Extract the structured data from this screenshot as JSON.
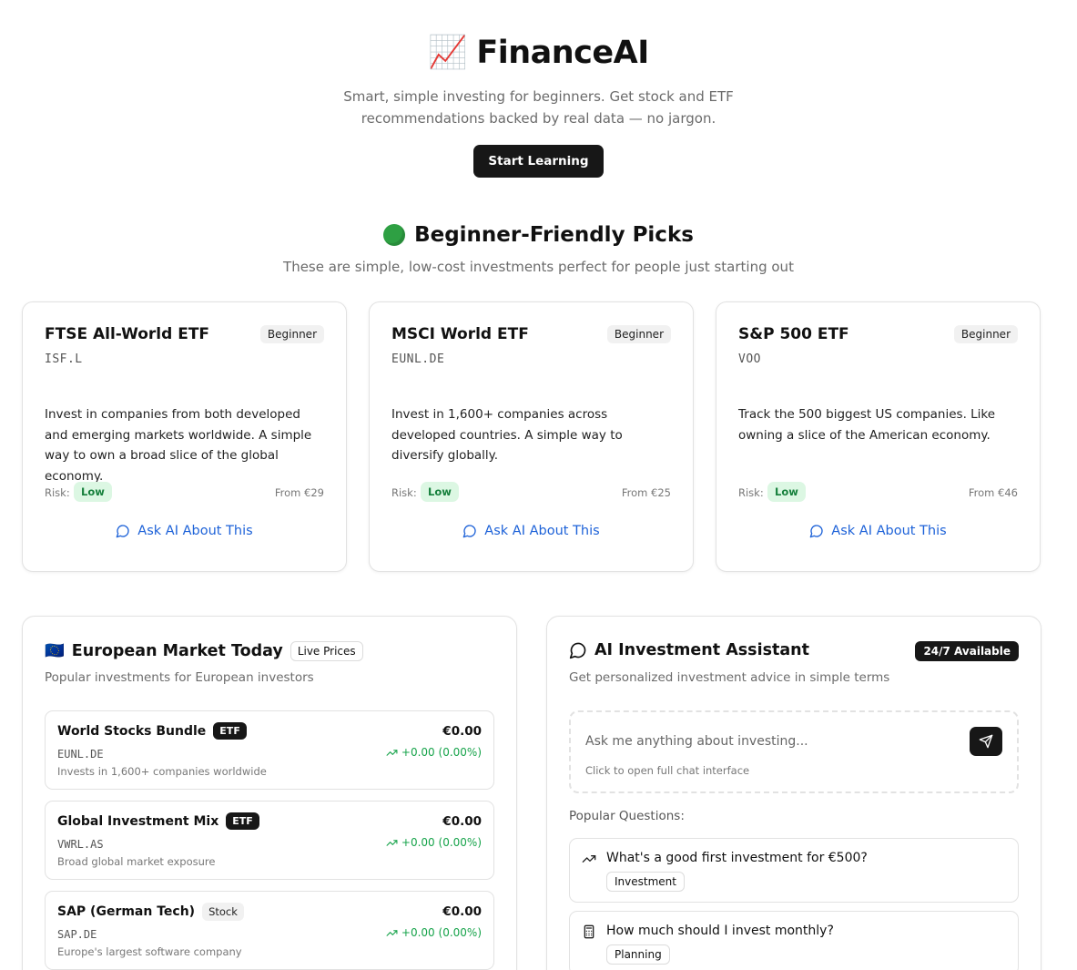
{
  "hero": {
    "emoji": "📈",
    "title": "FinanceAI",
    "subtitle": "Smart, simple investing for beginners. Get stock and ETF recommendations backed by real data — no jargon.",
    "cta_label": "Start Learning"
  },
  "picks": {
    "title": "Beginner-Friendly Picks",
    "subtitle": "These are simple, low-cost investments perfect for people just starting out",
    "risk_label": "Risk:",
    "ask_label": "Ask AI About This",
    "cards": [
      {
        "name": "FTSE All-World ETF",
        "level": "Beginner",
        "ticker": "ISF.L",
        "description": "Invest in companies from both developed and emerging markets worldwide. A simple way to own a broad slice of the global economy.",
        "risk": "Low",
        "price": "From €29"
      },
      {
        "name": "MSCI World ETF",
        "level": "Beginner",
        "ticker": "EUNL.DE",
        "description": "Invest in 1,600+ companies across developed countries. A simple way to diversify globally.",
        "risk": "Low",
        "price": "From €25"
      },
      {
        "name": "S&P 500 ETF",
        "level": "Beginner",
        "ticker": "VOO",
        "description": "Track the 500 biggest US companies. Like owning a slice of the American economy.",
        "risk": "Low",
        "price": "From €46"
      }
    ]
  },
  "market": {
    "flag": "🇪🇺",
    "title": "European Market Today",
    "badge": "Live Prices",
    "subtitle": "Popular investments for European investors",
    "items": [
      {
        "name": "World Stocks Bundle",
        "type": "ETF",
        "ticker": "EUNL.DE",
        "description": "Invests in 1,600+ companies worldwide",
        "price": "€0.00",
        "change": "+0.00 (0.00%)"
      },
      {
        "name": "Global Investment Mix",
        "type": "ETF",
        "ticker": "VWRL.AS",
        "description": "Broad global market exposure",
        "price": "€0.00",
        "change": "+0.00 (0.00%)"
      },
      {
        "name": "SAP (German Tech)",
        "type": "Stock",
        "ticker": "SAP.DE",
        "description": "Europe's largest software company",
        "price": "€0.00",
        "change": "+0.00 (0.00%)"
      }
    ]
  },
  "assistant": {
    "title": "AI Investment Assistant",
    "badge": "24/7 Available",
    "subtitle": "Get personalized investment advice in simple terms",
    "input_placeholder": "Ask me anything about investing...",
    "input_hint": "Click to open full chat interface",
    "popular_label": "Popular Questions:",
    "questions": [
      {
        "icon": "trending-up-icon",
        "text": "What's a good first investment for €500?",
        "tag": "Investment"
      },
      {
        "icon": "calculator-icon",
        "text": "How much should I invest monthly?",
        "tag": "Planning"
      }
    ]
  },
  "colors": {
    "accent_blue": "#1d62d8",
    "positive_green": "#16a34a",
    "dark": "#171717"
  }
}
